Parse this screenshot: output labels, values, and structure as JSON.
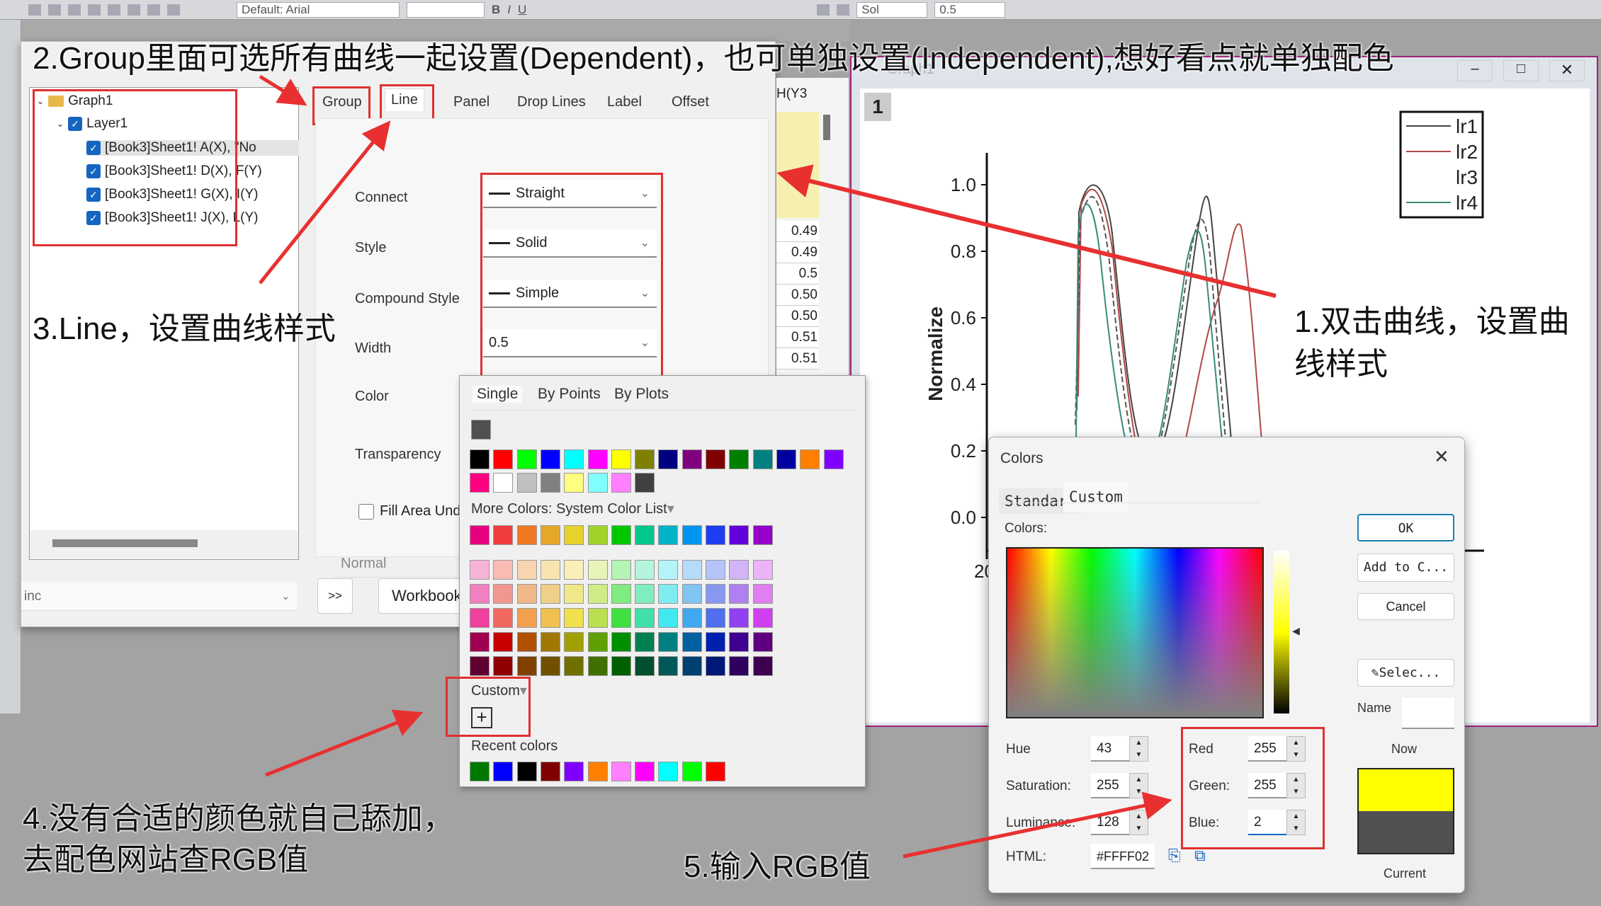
{
  "toolbar": {
    "font": "Default: Arial",
    "line_style": "Sol",
    "line_width": "0.5"
  },
  "plot_details": {
    "tree": {
      "root": "Graph1",
      "layer": "Layer1",
      "plots": [
        "[Book3]Sheet1! A(X), \"No",
        "[Book3]Sheet1! D(X), F(Y)",
        "[Book3]Sheet1! G(X), I(Y)",
        "[Book3]Sheet1! J(X), L(Y)"
      ]
    },
    "tabs": [
      "Group",
      "Line",
      "Panel",
      "Drop Lines",
      "Label",
      "Offset"
    ],
    "active_tab": "Line",
    "fields": {
      "connect_label": "Connect",
      "connect_value": "Straight",
      "style_label": "Style",
      "style_value": "Solid",
      "compound_label": "Compound Style",
      "compound_value": "Simple",
      "width_label": "Width",
      "width_value": "0.5",
      "color_label": "Color",
      "transparency_label": "Transparency",
      "fill_area_label": "Fill Area Unde",
      "normal_label": "Normal"
    },
    "bottom": {
      "combo_value": "inc",
      "arrow_button": ">>",
      "workbook_button": "Workbook"
    }
  },
  "color_popup": {
    "tabs": [
      "Single",
      "By Points",
      "By Plots"
    ],
    "current_swatch": "#505050",
    "basic_colors": [
      [
        "#000000",
        "#ff0000",
        "#00ff00",
        "#0000ff",
        "#00ffff",
        "#ff00ff",
        "#ffff00",
        "#808000",
        "#000080",
        "#800080",
        "#800000",
        "#008000",
        "#008080",
        "#0000a0",
        "#ff8000",
        "#8000ff"
      ],
      [
        "#ff0080",
        "#ffffff",
        "#c0c0c0",
        "#808080",
        "#ffff80",
        "#80ffff",
        "#ff80ff",
        "#404040"
      ]
    ],
    "more_colors_label": "More Colors: System Color List",
    "more_colors": [
      [
        "#e6007e",
        "#f03c3c",
        "#f07820",
        "#e6a82a",
        "#e6d22a",
        "#a0d22a",
        "#00c800",
        "#00c88c",
        "#00b4c8",
        "#0096f0",
        "#1e3cf0",
        "#6400dc",
        "#9600c8"
      ],
      [
        "#f8b4d8",
        "#f8bcb4",
        "#f8d4b0",
        "#f8e4b0",
        "#f8f0b8",
        "#e8f4b8",
        "#b4f4b4",
        "#b4f4dc",
        "#b4f4f8",
        "#b4dcf8",
        "#b4c4f8",
        "#d4b4f8",
        "#ecb4f8"
      ],
      [
        "#f080c0",
        "#f09890",
        "#f0b888",
        "#f0d088",
        "#f0e888",
        "#d0ec88",
        "#80ec80",
        "#80ecc0",
        "#80ecf0",
        "#80c4f0",
        "#8898f0",
        "#b080f0",
        "#e080f0"
      ],
      [
        "#f040a0",
        "#f06860",
        "#f0a050",
        "#f0c050",
        "#f0e050",
        "#b8e050",
        "#40e040",
        "#40e0a8",
        "#40e8f0",
        "#40a8f0",
        "#5070f0",
        "#9040f0",
        "#d040f0"
      ],
      [
        "#a00050",
        "#c80000",
        "#b05000",
        "#a07800",
        "#a0a000",
        "#60a000",
        "#009000",
        "#008050",
        "#008080",
        "#0060a0",
        "#0020b0",
        "#400090",
        "#600080"
      ],
      [
        "#600030",
        "#900000",
        "#804000",
        "#705000",
        "#707000",
        "#407000",
        "#006000",
        "#005030",
        "#005858",
        "#004070",
        "#001878",
        "#300060",
        "#400050"
      ]
    ],
    "custom_label": "Custom",
    "recent_label": "Recent colors",
    "recent_colors": [
      "#007800",
      "#0000ff",
      "#000000",
      "#800000",
      "#8000ff",
      "#ff8000",
      "#ff80ff",
      "#ff00ff",
      "#00ffff",
      "#00ff00",
      "#ff0000"
    ]
  },
  "worksheet": {
    "header": "H(Y3",
    "values": [
      "0.49",
      "0.49",
      "0.5",
      "0.50",
      "0.50",
      "0.51",
      "0.51"
    ]
  },
  "graph": {
    "title": "Graph1",
    "layer_number": "1",
    "ylabel": "Normalize",
    "yticks": [
      "1.0",
      "0.8",
      "0.6",
      "0.4",
      "0.2",
      "0.0"
    ],
    "xtick_partial": "20",
    "legend": [
      {
        "name": "lr1",
        "color": "#444444"
      },
      {
        "name": "lr2",
        "color": "#b04848"
      },
      {
        "name": "lr3",
        "color": "#ffffff"
      },
      {
        "name": "lr4",
        "color": "#3a8a7a"
      }
    ]
  },
  "colors_dialog": {
    "title": "Colors",
    "tabs": [
      "Standard",
      "Custom"
    ],
    "colors_label": "Colors:",
    "hue_label": "Hue",
    "hue": "43",
    "sat_label": "Saturation:",
    "sat": "255",
    "lum_label": "Luminance:",
    "lum": "128",
    "html_label": "HTML:",
    "html": "#FFFF02",
    "red_label": "Red",
    "red": "255",
    "green_label": "Green:",
    "green": "255",
    "blue_label": "Blue:",
    "blue": "2",
    "ok": "OK",
    "add": "Add to C...",
    "cancel": "Cancel",
    "select": "Selec...",
    "name_label": "Name",
    "now_label": "Now",
    "current_label": "Current",
    "new_color": "#ffff02",
    "current_color": "#505050"
  },
  "annotations": {
    "step2": "2.Group里面可选所有曲线一起设置(Dependent)，也可单独设置(Independent),想好看点就单独配色",
    "step3": "3.Line，设置曲线样式",
    "step1_a": "1.双击曲线，设置曲",
    "step1_b": "线样式",
    "step4_a": "4.没有合适的颜色就自己舔加，",
    "step4_b": "去配色网站查RGB值",
    "step5": "5.输入RGB值"
  },
  "accent_red": "#e03030"
}
